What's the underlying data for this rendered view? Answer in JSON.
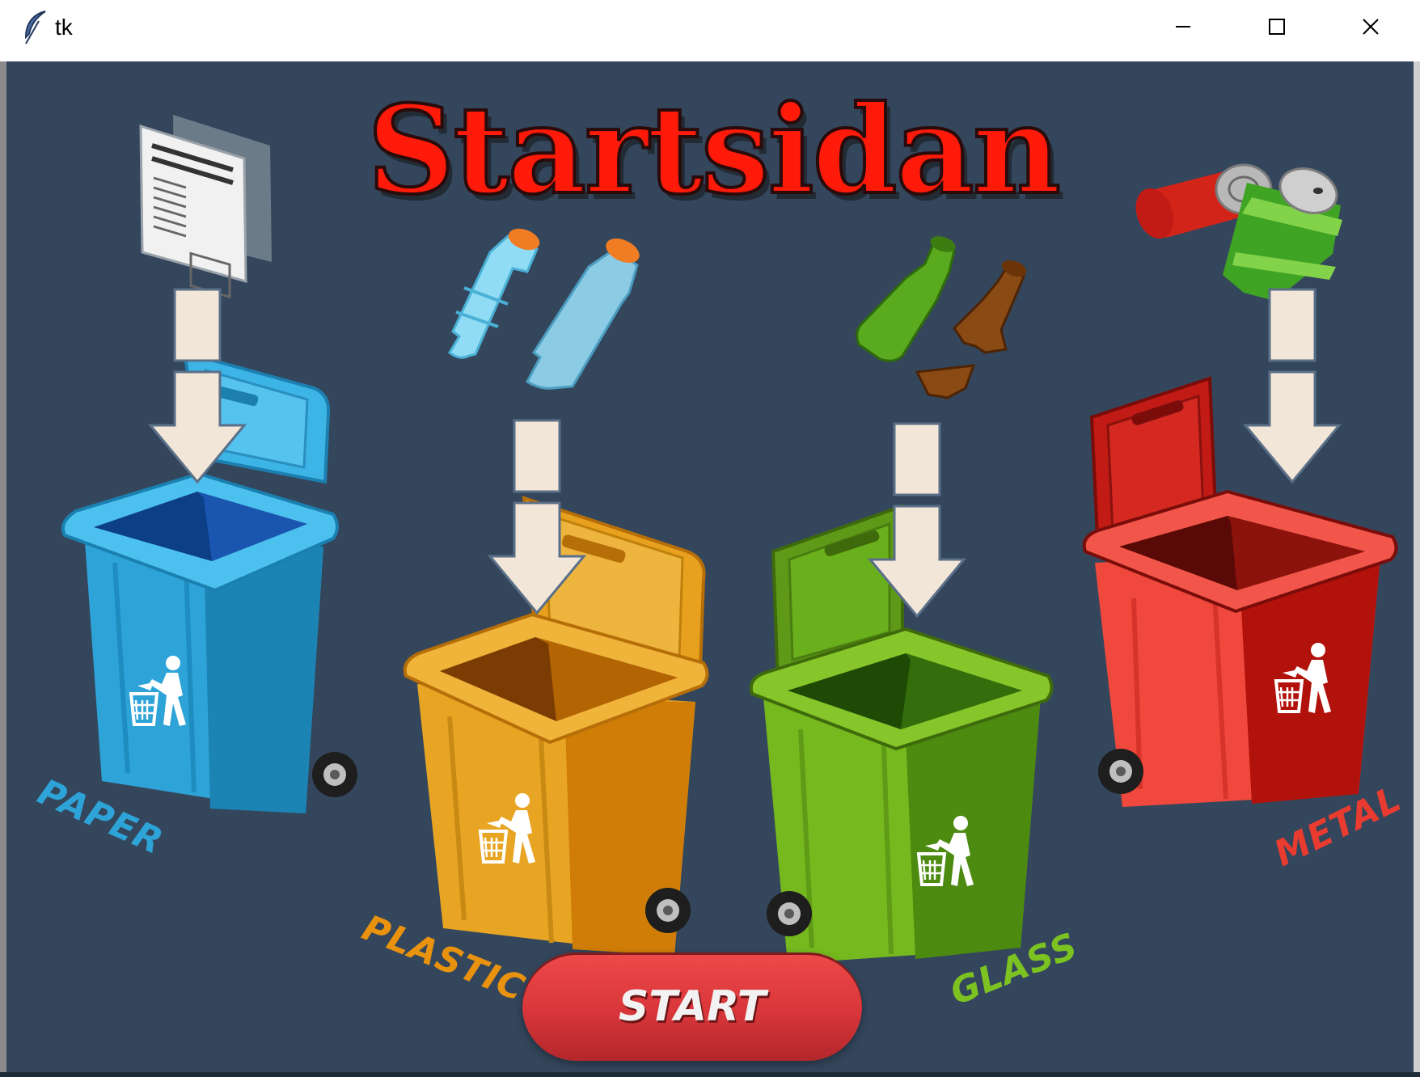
{
  "window": {
    "title": "tk",
    "icon": "feather-icon",
    "controls": [
      "minimize-icon",
      "maximize-icon",
      "close-icon"
    ]
  },
  "page": {
    "heading": "Startsidan",
    "bins": [
      {
        "label": "PAPER",
        "color": "#3cb5e6",
        "item_icon": "newspaper-icon"
      },
      {
        "label": "PLASTIC",
        "color": "#e8a11e",
        "item_icon": "plastic-bottles-icon"
      },
      {
        "label": "GLASS",
        "color": "#6aaf1c",
        "item_icon": "glass-bottles-icon"
      },
      {
        "label": "METAL",
        "color": "#e43a30",
        "item_icon": "metal-cans-icon"
      }
    ],
    "start_button": "START"
  },
  "colors": {
    "background": "#34465c",
    "heading": "#ff1a0a",
    "start_button": "#d8363a",
    "arrow": "#f2e6d8"
  }
}
